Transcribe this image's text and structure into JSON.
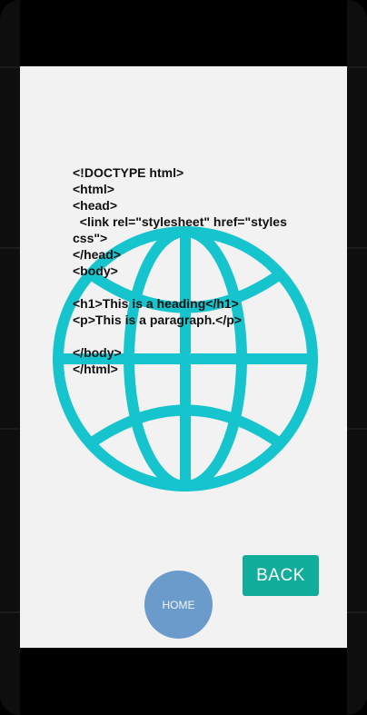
{
  "colors": {
    "globe": "#15c4cc",
    "back_button": "#10ad9b",
    "home_button": "#6a9bcb",
    "screen_background": "#f2f2f3"
  },
  "content": {
    "globe_icon": "globe-icon",
    "code_text": "<!DOCTYPE html>\n<html>\n<head>\n  <link rel=\"stylesheet\" href=\"styles.\ncss\">\n</head>\n<body>\n\n<h1>This is a heading</h1>\n<p>This is a paragraph.</p>\n\n</body>\n</html>"
  },
  "buttons": {
    "back_label": "BACK",
    "home_label": "HOME"
  }
}
